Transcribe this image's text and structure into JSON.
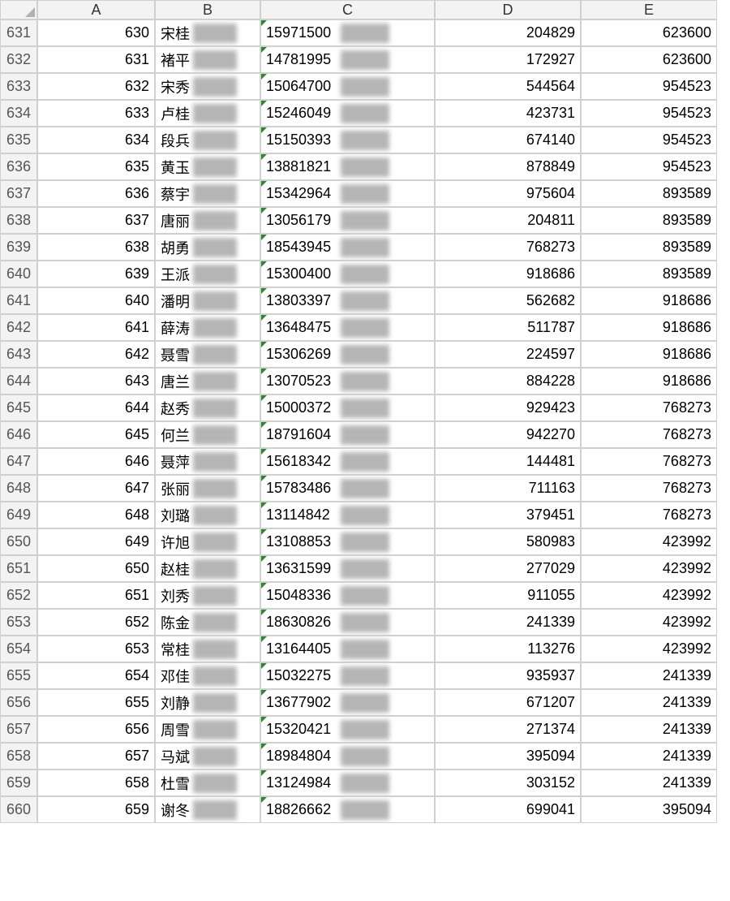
{
  "columns": [
    "A",
    "B",
    "C",
    "D",
    "E"
  ],
  "rows": [
    {
      "r": "631",
      "a": "630",
      "b": "宋桂",
      "c": "15971500",
      "d": "204829",
      "e": "623600"
    },
    {
      "r": "632",
      "a": "631",
      "b": "褚平",
      "c": "14781995",
      "d": "172927",
      "e": "623600"
    },
    {
      "r": "633",
      "a": "632",
      "b": "宋秀",
      "c": "15064700",
      "d": "544564",
      "e": "954523"
    },
    {
      "r": "634",
      "a": "633",
      "b": "卢桂",
      "c": "15246049",
      "d": "423731",
      "e": "954523"
    },
    {
      "r": "635",
      "a": "634",
      "b": "段兵",
      "c": "15150393",
      "d": "674140",
      "e": "954523"
    },
    {
      "r": "636",
      "a": "635",
      "b": "黄玉",
      "c": "13881821",
      "d": "878849",
      "e": "954523"
    },
    {
      "r": "637",
      "a": "636",
      "b": "蔡宇",
      "c": "15342964",
      "d": "975604",
      "e": "893589"
    },
    {
      "r": "638",
      "a": "637",
      "b": "唐丽",
      "c": "13056179",
      "d": "204811",
      "e": "893589"
    },
    {
      "r": "639",
      "a": "638",
      "b": "胡勇",
      "c": "18543945",
      "d": "768273",
      "e": "893589"
    },
    {
      "r": "640",
      "a": "639",
      "b": "王派",
      "c": "15300400",
      "d": "918686",
      "e": "893589"
    },
    {
      "r": "641",
      "a": "640",
      "b": "潘明",
      "c": "13803397",
      "d": "562682",
      "e": "918686"
    },
    {
      "r": "642",
      "a": "641",
      "b": "薛涛",
      "c": "13648475",
      "d": "511787",
      "e": "918686"
    },
    {
      "r": "643",
      "a": "642",
      "b": "聂雪",
      "c": "15306269",
      "d": "224597",
      "e": "918686"
    },
    {
      "r": "644",
      "a": "643",
      "b": "唐兰",
      "c": "13070523",
      "d": "884228",
      "e": "918686"
    },
    {
      "r": "645",
      "a": "644",
      "b": "赵秀",
      "c": "15000372",
      "d": "929423",
      "e": "768273"
    },
    {
      "r": "646",
      "a": "645",
      "b": "何兰",
      "c": "18791604",
      "d": "942270",
      "e": "768273"
    },
    {
      "r": "647",
      "a": "646",
      "b": "聂萍",
      "c": "15618342",
      "d": "144481",
      "e": "768273"
    },
    {
      "r": "648",
      "a": "647",
      "b": "张丽",
      "c": "15783486",
      "d": "711163",
      "e": "768273"
    },
    {
      "r": "649",
      "a": "648",
      "b": "刘璐",
      "c": "13114842",
      "d": "379451",
      "e": "768273"
    },
    {
      "r": "650",
      "a": "649",
      "b": "许旭",
      "c": "13108853",
      "d": "580983",
      "e": "423992"
    },
    {
      "r": "651",
      "a": "650",
      "b": "赵桂",
      "c": "13631599",
      "d": "277029",
      "e": "423992"
    },
    {
      "r": "652",
      "a": "651",
      "b": "刘秀",
      "c": "15048336",
      "d": "911055",
      "e": "423992"
    },
    {
      "r": "653",
      "a": "652",
      "b": "陈金",
      "c": "18630826",
      "d": "241339",
      "e": "423992"
    },
    {
      "r": "654",
      "a": "653",
      "b": "常桂",
      "c": "13164405",
      "d": "113276",
      "e": "423992"
    },
    {
      "r": "655",
      "a": "654",
      "b": "邓佳",
      "c": "15032275",
      "d": "935937",
      "e": "241339"
    },
    {
      "r": "656",
      "a": "655",
      "b": "刘静",
      "c": "13677902",
      "d": "671207",
      "e": "241339"
    },
    {
      "r": "657",
      "a": "656",
      "b": "周雪",
      "c": "15320421",
      "d": "271374",
      "e": "241339"
    },
    {
      "r": "658",
      "a": "657",
      "b": "马斌",
      "c": "18984804",
      "d": "395094",
      "e": "241339"
    },
    {
      "r": "659",
      "a": "658",
      "b": "杜雪",
      "c": "13124984",
      "d": "303152",
      "e": "241339"
    },
    {
      "r": "660",
      "a": "659",
      "b": "谢冬",
      "c": "18826662",
      "d": "699041",
      "e": "395094"
    }
  ]
}
